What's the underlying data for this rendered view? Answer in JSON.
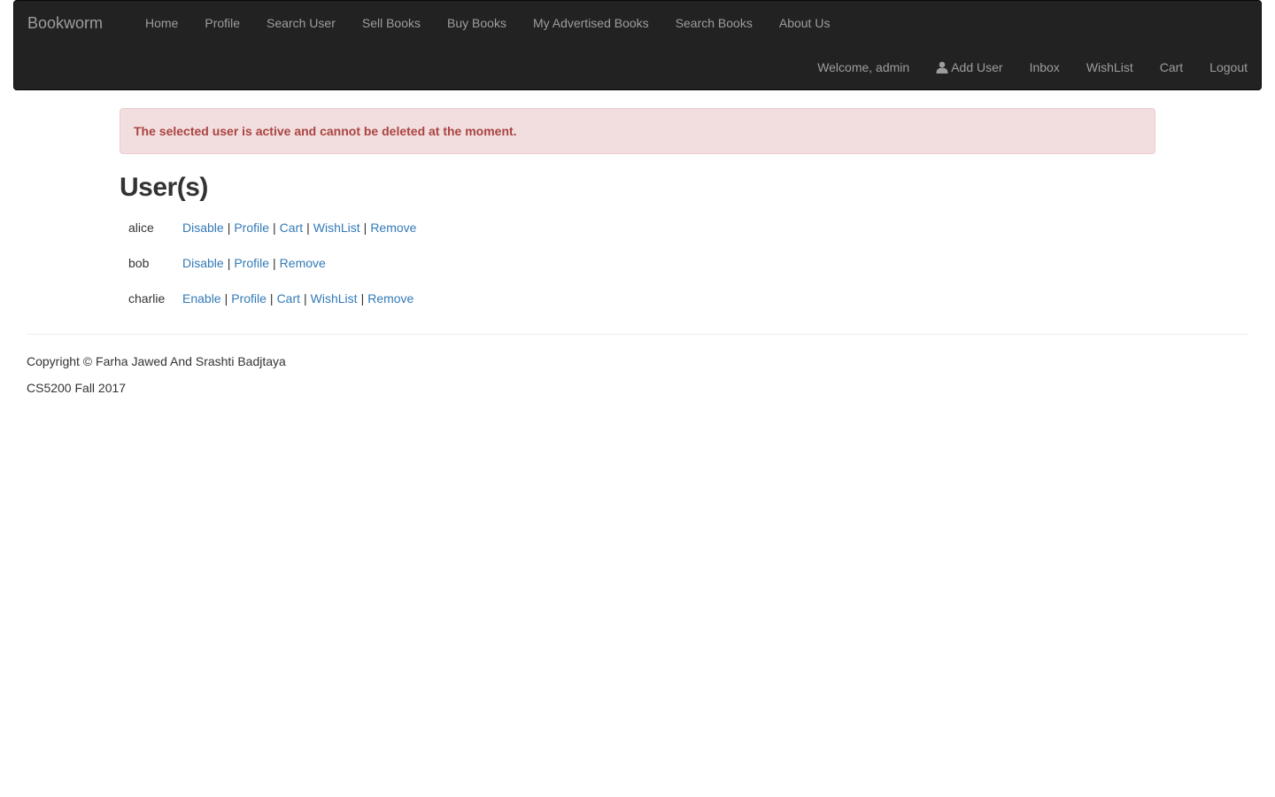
{
  "navbar": {
    "brand": "Bookworm",
    "left_items": [
      {
        "label": "Home"
      },
      {
        "label": "Profile"
      },
      {
        "label": "Search User"
      },
      {
        "label": "Sell Books"
      },
      {
        "label": "Buy Books"
      },
      {
        "label": "My Advertised Books"
      },
      {
        "label": "Search Books"
      },
      {
        "label": "About Us"
      }
    ],
    "right_items": {
      "welcome": "Welcome, admin",
      "add_user": "Add User",
      "inbox": "Inbox",
      "wishlist": "WishList",
      "cart": "Cart",
      "logout": "Logout"
    },
    "icons": {
      "add_user": "user-icon"
    }
  },
  "alert": {
    "message": "The selected user is active and cannot be deleted at the moment."
  },
  "page": {
    "title": "User(s)"
  },
  "users": [
    {
      "name": "alice",
      "toggle": "Disable",
      "profile": "Profile",
      "cart": "Cart",
      "wishlist": "WishList",
      "remove": "Remove"
    },
    {
      "name": "bob",
      "toggle": "Disable",
      "profile": "Profile",
      "remove": "Remove"
    },
    {
      "name": "charlie",
      "toggle": "Enable",
      "profile": "Profile",
      "cart": "Cart",
      "wishlist": "WishList",
      "remove": "Remove"
    }
  ],
  "separator": "|",
  "footer": {
    "copyright": "Copyright © Farha Jawed And Srashti Badjtaya",
    "course": "CS5200 Fall 2017"
  },
  "colors": {
    "navbar_bg": "#222222",
    "nav_link": "#9d9d9d",
    "alert_bg": "#f2dede",
    "alert_text": "#a94442",
    "link": "#337ab7"
  }
}
